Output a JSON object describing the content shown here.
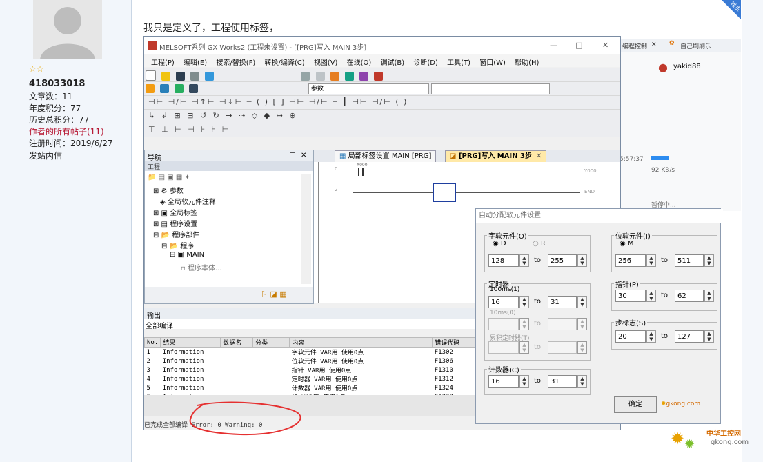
{
  "user": {
    "stars": "☆☆",
    "name": "418033018",
    "posts_label": "文章数：11",
    "year_points": "年度积分：77",
    "history_points": "历史总积分：77",
    "all_posts_link": "作者的所有帖子(11)",
    "register": "注册时间：2019/6/27",
    "message": "发站内信"
  },
  "post": {
    "text": "我只是定义了，工程使用标签，",
    "badge": "楼主"
  },
  "gxworks": {
    "title": "MELSOFT系列 GX Works2 (工程未设置) - [[PRG]写入 MAIN 3步]",
    "win_controls": [
      "—",
      "□",
      "✕"
    ],
    "menu": [
      "工程(P)",
      "编辑(E)",
      "搜索/替换(F)",
      "转换/编译(C)",
      "视图(V)",
      "在线(O)",
      "调试(B)",
      "诊断(D)",
      "工具(T)",
      "窗口(W)",
      "帮助(H)"
    ],
    "toolbar_combo": "参数",
    "nav": {
      "title": "导航",
      "section": "工程",
      "tree": [
        "参数",
        "全局软元件注释",
        "全局标签",
        "程序设置",
        "程序部件",
        "程序",
        "MAIN",
        "程序本体..."
      ]
    },
    "tabs": [
      "局部标签设置 MAIN [PRG]",
      "[PRG]写入 MAIN 3步"
    ],
    "ladder": {
      "row1": "0",
      "row2": "2",
      "coil1": "Y000",
      "coil2": "END",
      "contact": "X000"
    },
    "output": {
      "title": "输出",
      "subtitle": "全部编译",
      "headers": [
        "No.",
        "结果",
        "数据名",
        "分类",
        "内容",
        "错误代码"
      ],
      "rows": [
        [
          "1",
          "Information",
          "—",
          "—",
          "字软元件 VAR用 使用0点",
          "F1302"
        ],
        [
          "2",
          "Information",
          "—",
          "—",
          "位软元件 VAR用 使用0点",
          "F1306"
        ],
        [
          "3",
          "Information",
          "—",
          "—",
          "指针 VAR用 使用0点",
          "F1310"
        ],
        [
          "4",
          "Information",
          "—",
          "—",
          "定时器 VAR用 使用0点",
          "F1312"
        ],
        [
          "5",
          "Information",
          "—",
          "—",
          "计数器 VAR用 使用0点",
          "F1324"
        ],
        [
          "6",
          "Information",
          "—",
          "—",
          "步 VAR用 使用0点",
          "F1328"
        ]
      ],
      "status": "已完成全部编译 Error: 0 Warning: 0"
    }
  },
  "background_browser": {
    "tab1": "编程控制",
    "tab2": "自己刷刷乐",
    "user": "yakid88",
    "time": "5:57:37",
    "speed": "92 KB/s",
    "status": "暂停中..."
  },
  "dialog": {
    "title": "自动分配软元件设置",
    "word": {
      "label": "字软元件(O)",
      "radio_d": "D",
      "radio_r": "R",
      "from": "128",
      "to": "255"
    },
    "bit": {
      "label": "位软元件(I)",
      "radio_m": "M",
      "from": "256",
      "to": "511"
    },
    "timer": {
      "label": "定时器",
      "t100": "100ms(1)",
      "from": "16",
      "to": "31",
      "t10": "10ms(0)",
      "accum": "累积定时器(T)"
    },
    "pointer": {
      "label": "指针(P)",
      "from": "30",
      "to": "62"
    },
    "step": {
      "label": "步标志(S)",
      "from": "20",
      "to": "127"
    },
    "counter": {
      "label": "计数器(C)",
      "from": "16",
      "to": "31"
    },
    "to_word": "to",
    "ok": "确定"
  },
  "watermark": {
    "site": "中华工控网",
    "domain": "gkong.com"
  },
  "colors": {
    "accent": "#3a7bd5",
    "annotation": "#e53030",
    "stars": "#e8a600"
  }
}
